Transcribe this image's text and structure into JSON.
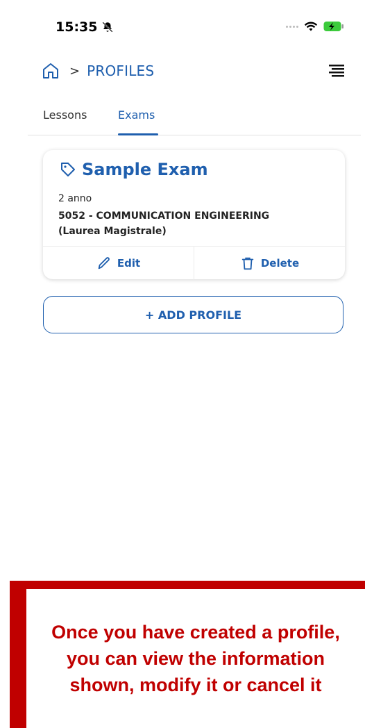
{
  "status_bar": {
    "time": "15:35",
    "mute_icon": "bell-slash-icon",
    "wifi_icon": "wifi-icon",
    "battery_icon": "battery-charging-icon"
  },
  "header": {
    "home_icon": "home-icon",
    "separator": ">",
    "title": "PROFILES",
    "menu_icon": "menu-icon"
  },
  "tabs": [
    {
      "label": "Lessons",
      "active": false
    },
    {
      "label": "Exams",
      "active": true
    }
  ],
  "profile_card": {
    "icon": "tag-icon",
    "title": "Sample Exam",
    "year": "2 anno",
    "course_line1": "5052 - COMMUNICATION ENGINEERING",
    "course_line2": "(Laurea Magistrale)",
    "edit_label": "Edit",
    "delete_label": "Delete"
  },
  "add_profile_label": "+ ADD PROFILE",
  "annotation": {
    "text": "Once you have created a profile, you can view the information shown, modify it or cancel it"
  },
  "colors": {
    "accent": "#1f5fae",
    "annotation_red": "#c00000"
  }
}
